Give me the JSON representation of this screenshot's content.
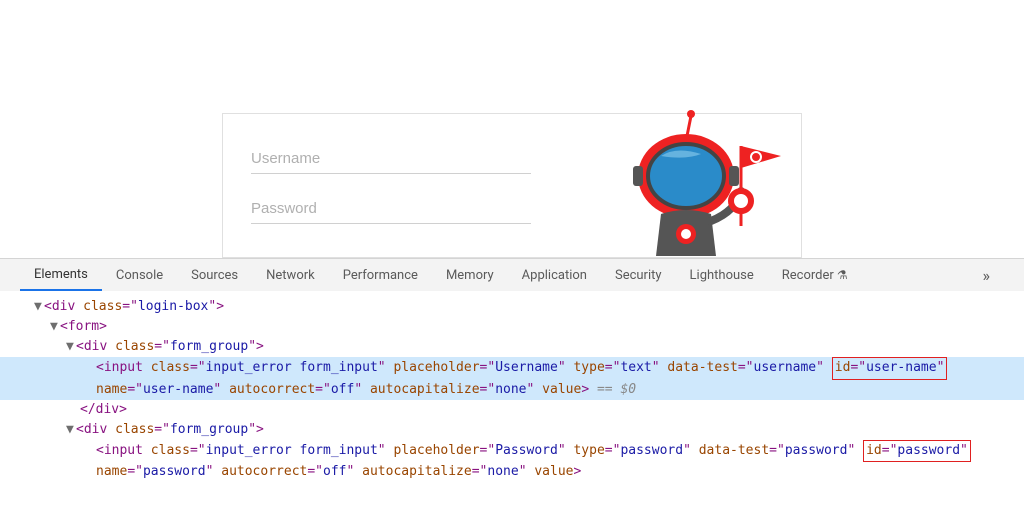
{
  "form": {
    "username_placeholder": "Username",
    "password_placeholder": "Password"
  },
  "devtools": {
    "tabs": {
      "elements": "Elements",
      "console": "Console",
      "sources": "Sources",
      "network": "Network",
      "performance": "Performance",
      "memory": "Memory",
      "application": "Application",
      "security": "Security",
      "lighthouse": "Lighthouse",
      "recorder": "Recorder",
      "more": "»"
    },
    "dom": {
      "div_login": "div",
      "class_login": "login-box",
      "form_tag": "form",
      "div_fg": "div",
      "class_fg": "form_group",
      "input_tag": "input",
      "attr_class": "class",
      "val_class_input": "input_error form_input",
      "attr_placeholder": "placeholder",
      "val_ph_user": "Username",
      "val_ph_pass": "Password",
      "attr_type": "type",
      "val_type_text": "text",
      "val_type_pass": "password",
      "attr_datatest": "data-test",
      "val_dt_user": "username",
      "val_dt_pass": "password",
      "attr_id": "id",
      "val_id_user": "user-name",
      "val_id_pass": "password",
      "attr_name": "name",
      "val_name_user": "user-name",
      "val_name_pass": "password",
      "attr_autocorrect": "autocorrect",
      "val_off": "off",
      "attr_autocap": "autocapitalize",
      "val_none": "none",
      "attr_value": "value",
      "eq0": "== $0",
      "close_div": "/div"
    }
  }
}
